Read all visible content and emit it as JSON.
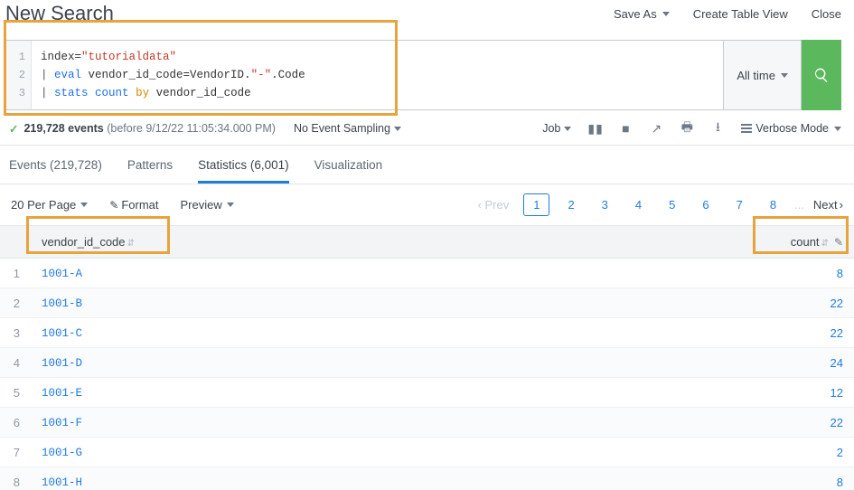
{
  "header": {
    "title": "New Search",
    "actions": {
      "save_as": "Save As",
      "create_table": "Create Table View",
      "close": "Close"
    }
  },
  "query": {
    "line1_a": "index=",
    "line1_b": "\"tutorialdata\"",
    "line2_a": "| ",
    "line2_b": "eval",
    "line2_c": " vendor_id_code=VendorID.",
    "line2_d": "\"-\"",
    "line2_e": ".Code",
    "line3_a": "| ",
    "line3_b": "stats",
    "line3_c": " ",
    "line3_d": "count",
    "line3_e": " ",
    "line3_f": "by",
    "line3_g": " vendor_id_code",
    "gutter": [
      "1",
      "2",
      "3"
    ]
  },
  "timerange": "All time",
  "jobbar": {
    "events_count": "219,728 events",
    "events_meta": "(before 9/12/22 11:05:34.000 PM)",
    "sampling": "No Event Sampling",
    "job": "Job",
    "verbose": "Verbose Mode"
  },
  "tabs": {
    "events": "Events (219,728)",
    "patterns": "Patterns",
    "statistics": "Statistics (6,001)",
    "visualization": "Visualization"
  },
  "subbar": {
    "per_page": "20 Per Page",
    "format": "Format",
    "preview": "Preview",
    "prev": "Prev",
    "next": "Next",
    "pages": [
      "1",
      "2",
      "3",
      "4",
      "5",
      "6",
      "7",
      "8"
    ],
    "ellipsis": "..."
  },
  "columns": {
    "vendor": "vendor_id_code",
    "count": "count"
  },
  "rows": [
    {
      "idx": "1",
      "vendor": "1001-A",
      "count": "8"
    },
    {
      "idx": "2",
      "vendor": "1001-B",
      "count": "22"
    },
    {
      "idx": "3",
      "vendor": "1001-C",
      "count": "22"
    },
    {
      "idx": "4",
      "vendor": "1001-D",
      "count": "24"
    },
    {
      "idx": "5",
      "vendor": "1001-E",
      "count": "12"
    },
    {
      "idx": "6",
      "vendor": "1001-F",
      "count": "22"
    },
    {
      "idx": "7",
      "vendor": "1001-G",
      "count": "2"
    },
    {
      "idx": "8",
      "vendor": "1001-H",
      "count": "8"
    }
  ]
}
